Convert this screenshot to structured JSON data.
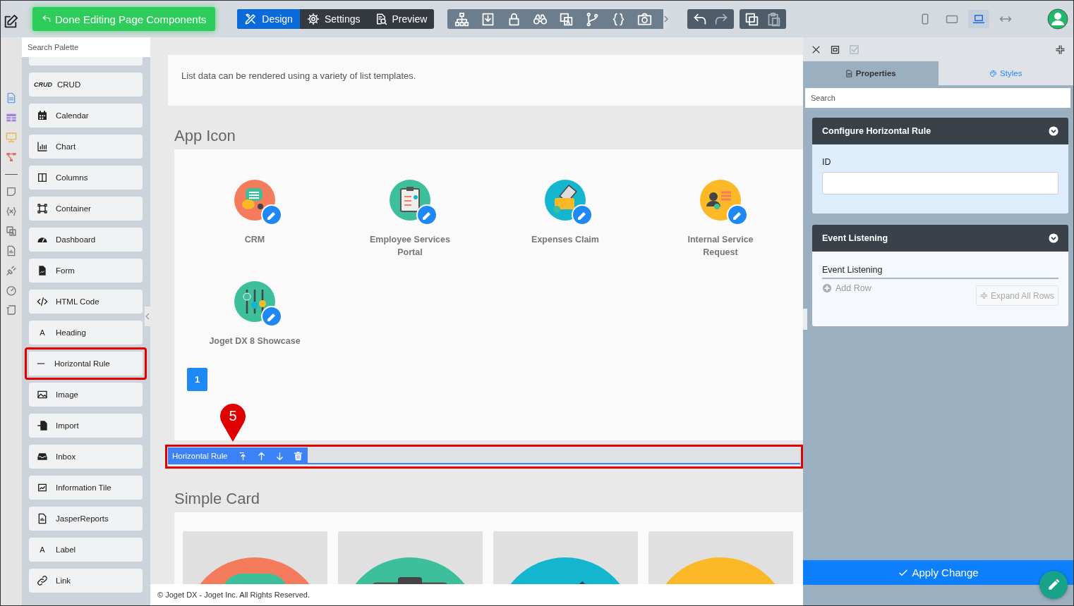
{
  "toolbar": {
    "done_button": "Done Editing Page Components",
    "modes": [
      {
        "label": "Design",
        "selected": true
      },
      {
        "label": "Settings",
        "selected": false
      },
      {
        "label": "Preview",
        "selected": false
      }
    ],
    "devices": [
      {
        "selected": false
      },
      {
        "selected": false
      },
      {
        "selected": true
      },
      {
        "selected": false
      }
    ]
  },
  "palette": {
    "search_placeholder": "Search Palette",
    "items": [
      {
        "label": "CRUD",
        "icon_text": "CRUD",
        "highlighted": false
      },
      {
        "label": "Calendar",
        "highlighted": false
      },
      {
        "label": "Chart",
        "highlighted": false
      },
      {
        "label": "Columns",
        "highlighted": false
      },
      {
        "label": "Container",
        "highlighted": false
      },
      {
        "label": "Dashboard",
        "highlighted": false
      },
      {
        "label": "Form",
        "highlighted": false
      },
      {
        "label": "HTML Code",
        "highlighted": false
      },
      {
        "label": "Heading",
        "icon_text": "A",
        "highlighted": false
      },
      {
        "label": "Horizontal Rule",
        "highlighted": true
      },
      {
        "label": "Image",
        "highlighted": false
      },
      {
        "label": "Import",
        "highlighted": false
      },
      {
        "label": "Inbox",
        "highlighted": false
      },
      {
        "label": "Information Tile",
        "highlighted": false
      },
      {
        "label": "JasperReports",
        "highlighted": false
      },
      {
        "label": "Label",
        "icon_text": "A",
        "highlighted": false
      },
      {
        "label": "Link",
        "highlighted": false
      }
    ]
  },
  "canvas": {
    "description": "List data can be rendered using a variety of list templates.",
    "app_icon_section": {
      "heading": "App Icon",
      "apps": [
        {
          "name": "CRM",
          "color": "#f47c5c"
        },
        {
          "name": "Employee Services Portal",
          "color": "#3dbf9c"
        },
        {
          "name": "Expenses Claim",
          "color": "#14b6cf"
        },
        {
          "name": "Internal Service Request",
          "color": "#fbb928"
        },
        {
          "name": "Joget DX 8 Showcase",
          "color": "#3dbf9c"
        }
      ],
      "pages": [
        {
          "label": "1",
          "selected": true
        }
      ]
    },
    "selected_component": {
      "label": "Horizontal Rule",
      "callout": "5"
    },
    "simple_card_section": {
      "heading": "Simple Card",
      "cards": [
        {
          "color": "#f47c5c"
        },
        {
          "color": "#3dbf9c"
        },
        {
          "color": "#14b6cf"
        },
        {
          "color": "#fbb928"
        }
      ]
    },
    "footer": "© Joget DX - Joget Inc. All Rights Reserved."
  },
  "properties_panel": {
    "tabs": [
      {
        "label": "Properties",
        "selected": true
      },
      {
        "label": "Styles",
        "selected": false
      }
    ],
    "search_placeholder": "Search",
    "sections": [
      {
        "kind": "fields",
        "title": "Configure Horizontal Rule",
        "expanded": true,
        "fields": [
          {
            "label": "ID"
          }
        ]
      },
      {
        "kind": "grid",
        "title": "Event Listening",
        "expanded": true,
        "grid_label": "Event Listening",
        "add_label": "Add Row",
        "expand_label": "Expand All Rows"
      }
    ],
    "apply_button": "Apply Change"
  }
}
